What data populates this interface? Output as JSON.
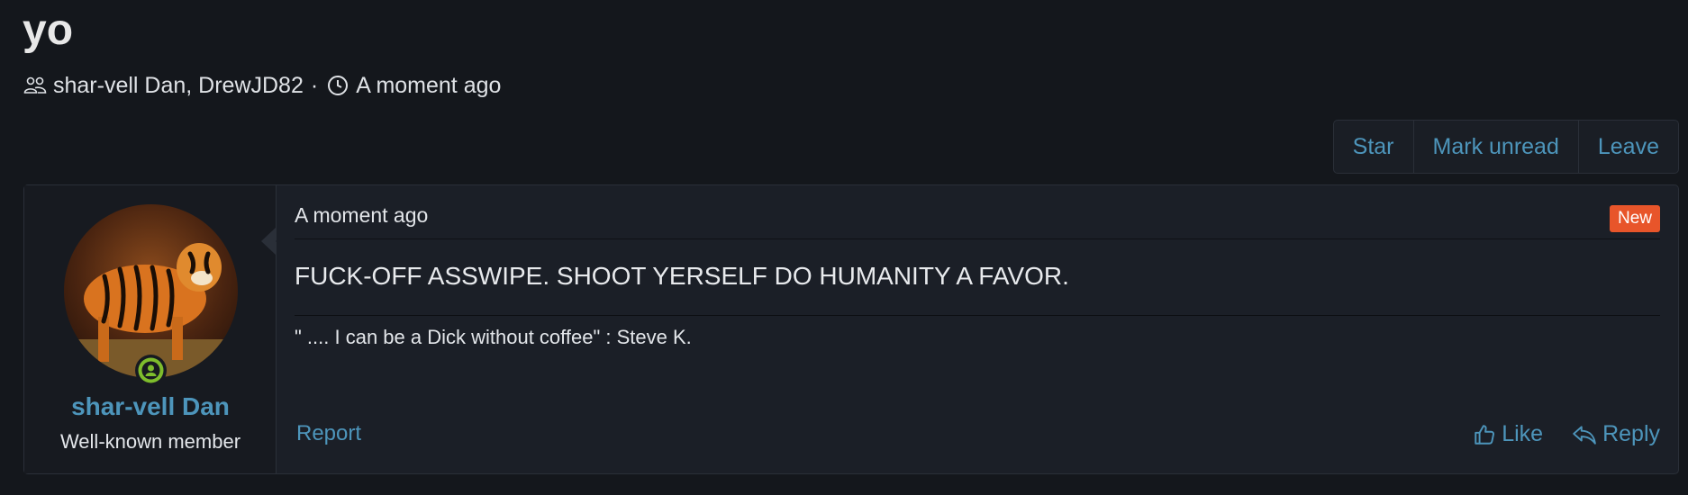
{
  "thread": {
    "title": "yo",
    "participants": "shar-vell Dan, DrewJD82",
    "separator": "·",
    "time": "A moment ago"
  },
  "actions": {
    "star": "Star",
    "mark_unread": "Mark unread",
    "leave": "Leave"
  },
  "message": {
    "author": {
      "name": "shar-vell Dan",
      "title": "Well-known member"
    },
    "date": "A moment ago",
    "badge": "New",
    "body": "FUCK-OFF ASSWIPE. SHOOT YERSELF DO HUMANITY A FAVOR.",
    "signature": "\" .... I can be a Dick without coffee\" : Steve K.",
    "report": "Report",
    "like": "Like",
    "reply": "Reply"
  },
  "icons": {
    "participants": "users-icon",
    "time": "clock-icon",
    "online": "online-status-icon",
    "like": "thumbs-up-icon",
    "reply": "reply-icon"
  },
  "colors": {
    "background": "#14171c",
    "link": "#4d95bb",
    "new_badge": "#e8552a",
    "online": "#7ebd2c"
  }
}
